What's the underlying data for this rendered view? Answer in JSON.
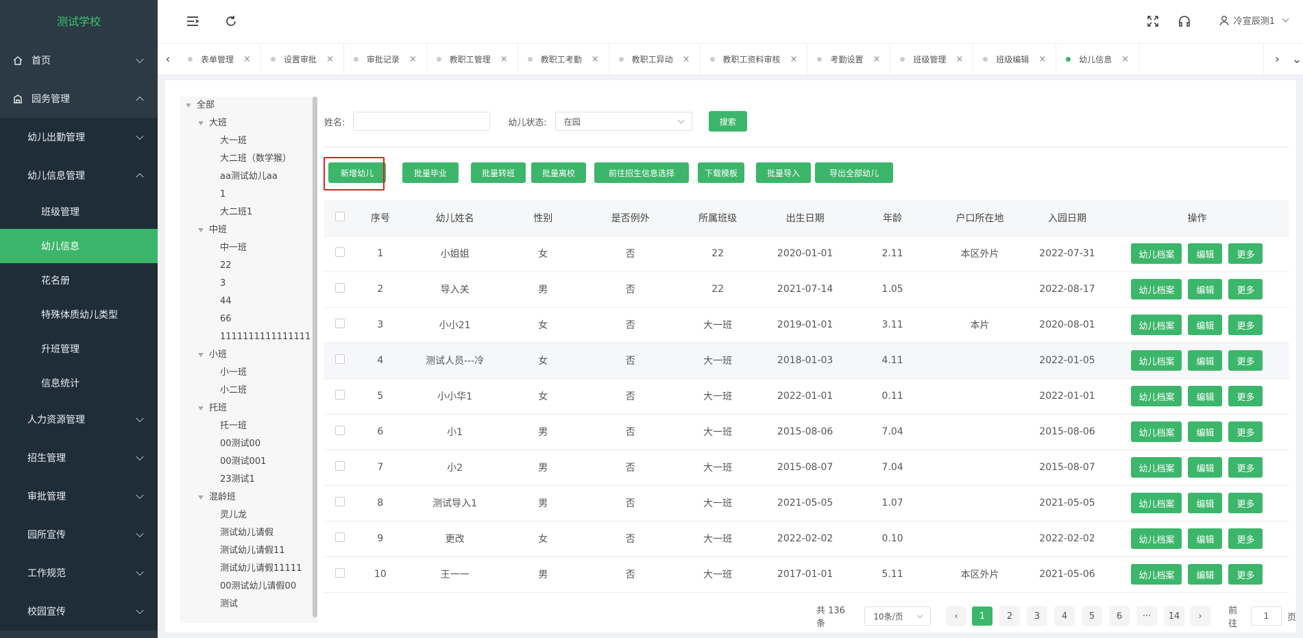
{
  "app": {
    "logo": "测试学校"
  },
  "sidebar": {
    "items": [
      {
        "label": "首页",
        "icon": "home-icon"
      },
      {
        "label": "园务管理",
        "icon": "building-icon"
      }
    ],
    "sub": [
      {
        "label": "幼儿出勤管理"
      },
      {
        "label": "幼儿信息管理"
      }
    ],
    "sub2": [
      {
        "label": "班级管理"
      },
      {
        "label": "幼儿信息"
      },
      {
        "label": "花名册"
      },
      {
        "label": "特殊体质幼儿类型"
      },
      {
        "label": "升班管理"
      },
      {
        "label": "信息统计"
      }
    ],
    "sub_after": [
      {
        "label": "人力资源管理"
      },
      {
        "label": "招生管理"
      },
      {
        "label": "审批管理"
      },
      {
        "label": "园所宣传"
      },
      {
        "label": "工作规范"
      },
      {
        "label": "校园宣传"
      }
    ]
  },
  "header": {
    "user": "冷宣辰测1"
  },
  "tabs": [
    "表单管理",
    "设置审批",
    "审批记录",
    "教职工管理",
    "教职工考勤",
    "教职工异动",
    "教职工资料审核",
    "考勤设置",
    "班级管理",
    "班级编辑",
    "幼儿信息"
  ],
  "tree": [
    {
      "label": "全部",
      "level": 0,
      "caret": true
    },
    {
      "label": "大班",
      "level": 1,
      "caret": true
    },
    {
      "label": "大一班",
      "level": 2
    },
    {
      "label": "大二班（数学猴）",
      "level": 2
    },
    {
      "label": "aa测试幼儿aa",
      "level": 2
    },
    {
      "label": "1",
      "level": 2
    },
    {
      "label": "大二班1",
      "level": 2
    },
    {
      "label": "中班",
      "level": 1,
      "caret": true
    },
    {
      "label": "中一班",
      "level": 2
    },
    {
      "label": "22",
      "level": 2
    },
    {
      "label": "3",
      "level": 2
    },
    {
      "label": "44",
      "level": 2
    },
    {
      "label": "66",
      "level": 2
    },
    {
      "label": "1111111111111111",
      "level": 2
    },
    {
      "label": "小班",
      "level": 1,
      "caret": true
    },
    {
      "label": "小一班",
      "level": 2
    },
    {
      "label": "小二班",
      "level": 2
    },
    {
      "label": "托班",
      "level": 1,
      "caret": true
    },
    {
      "label": "托一班",
      "level": 2
    },
    {
      "label": "00测试00",
      "level": 2
    },
    {
      "label": "00测试001",
      "level": 2
    },
    {
      "label": "23测试1",
      "level": 2
    },
    {
      "label": "混龄班",
      "level": 1,
      "caret": true
    },
    {
      "label": "灵儿龙",
      "level": 2
    },
    {
      "label": "测试幼儿请假",
      "level": 2
    },
    {
      "label": "测试幼儿请假11",
      "level": 2
    },
    {
      "label": "测试幼儿请假11111",
      "level": 2
    },
    {
      "label": "00测试幼儿请假00",
      "level": 2
    },
    {
      "label": "测试",
      "level": 2
    }
  ],
  "search": {
    "name_label": "姓名:",
    "name_value": "",
    "status_label": "幼儿状态:",
    "status_value": "在园",
    "search_btn": "搜索"
  },
  "actions": [
    "新增幼儿",
    "批量毕业",
    "批量转班",
    "批量离校",
    "前往招生信息选择",
    "下载模板",
    "批量导入",
    "导出全部幼儿"
  ],
  "table": {
    "headers": [
      "序号",
      "幼儿姓名",
      "性别",
      "是否例外",
      "所属班级",
      "出生日期",
      "年龄",
      "户口所在地",
      "入园日期",
      "操作"
    ],
    "rows": [
      [
        "1",
        "小姐姐",
        "女",
        "否",
        "22",
        "2020-01-01",
        "2.11",
        "本区外片",
        "2022-07-31"
      ],
      [
        "2",
        "导入关",
        "男",
        "否",
        "22",
        "2021-07-14",
        "1.05",
        "",
        "2022-08-17"
      ],
      [
        "3",
        "小小21",
        "女",
        "否",
        "大一班",
        "2019-01-01",
        "3.11",
        "本片",
        "2020-08-01"
      ],
      [
        "4",
        "测试人员---冷",
        "女",
        "否",
        "大一班",
        "2018-01-03",
        "4.11",
        "",
        "2022-01-05"
      ],
      [
        "5",
        "小小华1",
        "女",
        "否",
        "大一班",
        "2022-01-01",
        "0.11",
        "",
        "2022-01-01"
      ],
      [
        "6",
        "小1",
        "男",
        "否",
        "大一班",
        "2015-08-06",
        "7.04",
        "",
        "2015-08-06"
      ],
      [
        "7",
        "小2",
        "男",
        "否",
        "大一班",
        "2015-08-07",
        "7.04",
        "",
        "2015-08-07"
      ],
      [
        "8",
        "测试导入1",
        "男",
        "否",
        "大一班",
        "2021-05-05",
        "1.07",
        "",
        "2021-05-05"
      ],
      [
        "9",
        "更改",
        "女",
        "否",
        "大一班",
        "2022-02-02",
        "0.10",
        "",
        "2022-02-02"
      ],
      [
        "10",
        "王一一",
        "男",
        "否",
        "大一班",
        "2017-01-01",
        "5.11",
        "本区外片",
        "2021-05-06"
      ]
    ],
    "op_labels": [
      "幼儿档案",
      "编辑",
      "更多"
    ]
  },
  "pager": {
    "total": "共 136 条",
    "page_size": "10条/页",
    "pages": [
      "1",
      "2",
      "3",
      "4",
      "5",
      "6",
      "···",
      "14"
    ],
    "goto_label": "前往",
    "goto_value": "1",
    "page_unit": "页"
  },
  "colors": {
    "accent": "#3cb66a",
    "sidebar": "#2b3a45",
    "highlight": "#e02020"
  }
}
